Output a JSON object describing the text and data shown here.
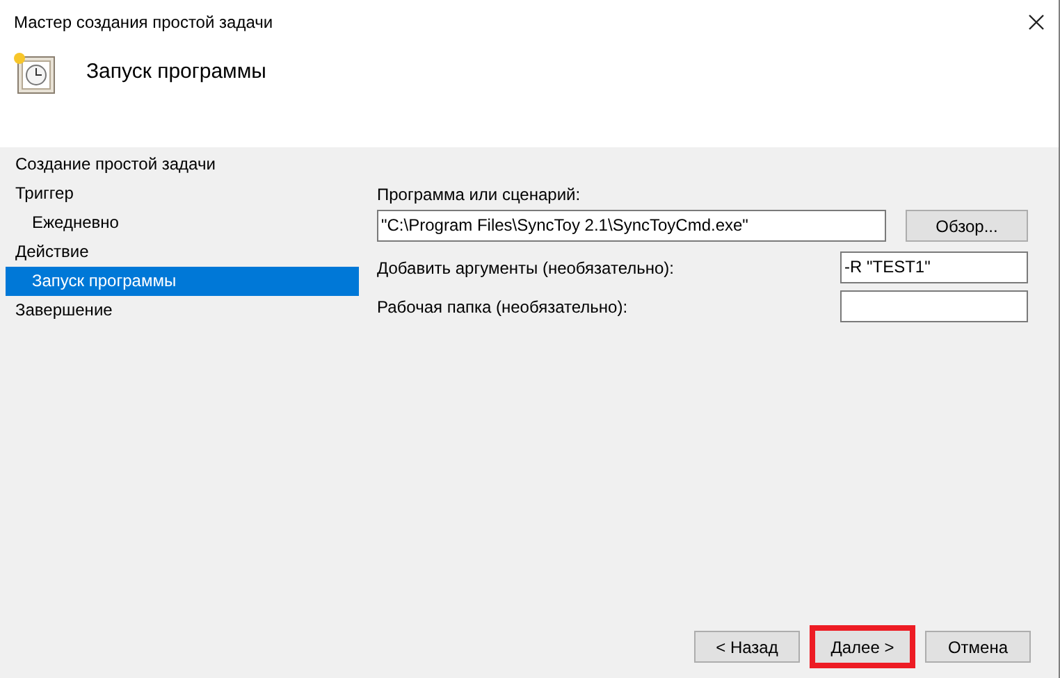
{
  "window": {
    "title": "Мастер создания простой задачи"
  },
  "header": {
    "title": "Запуск программы"
  },
  "steps": [
    {
      "label": "Создание простой задачи",
      "selected": false
    },
    {
      "label": "Триггер",
      "selected": false,
      "children": [
        {
          "label": "Ежедневно",
          "selected": false
        }
      ]
    },
    {
      "label": "Действие",
      "selected": false,
      "children": [
        {
          "label": "Запуск программы",
          "selected": true
        }
      ]
    },
    {
      "label": "Завершение",
      "selected": false
    }
  ],
  "program": {
    "label": "Программа или сценарий:",
    "value": "\"C:\\Program Files\\SyncToy 2.1\\SyncToyCmd.exe\"",
    "browse": "Обзор..."
  },
  "arguments": {
    "label": "Добавить аргументы (необязательно):",
    "value": "-R \"TEST1\""
  },
  "working_folder": {
    "label": "Рабочая папка (необязательно):"
  },
  "buttons": [
    {
      "label": "< Назад",
      "highlighted": false
    },
    {
      "label": "Далее >",
      "highlighted": true
    },
    {
      "label": "Отмена",
      "highlighted": false
    }
  ]
}
